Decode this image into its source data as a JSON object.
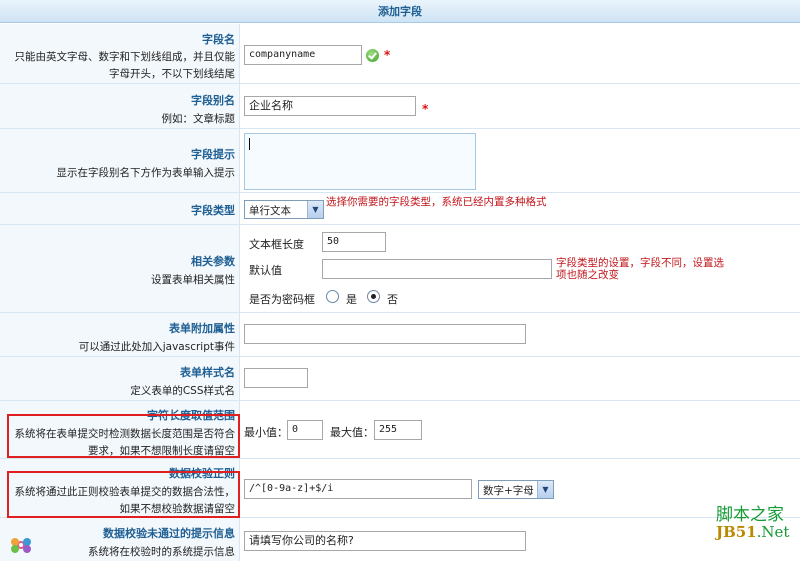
{
  "header": {
    "title": "添加字段"
  },
  "rows": {
    "field_name": {
      "label": "字段名",
      "desc1": "只能由英文字母、数字和下划线组成，并且仅能",
      "desc2": "字母开头，不以下划线结尾",
      "value": "companyname",
      "required": "*"
    },
    "field_alias": {
      "label": "字段别名",
      "desc": "例如：文章标题",
      "value": "企业名称",
      "required": "*"
    },
    "field_tip": {
      "label": "字段提示",
      "desc": "显示在字段别名下方作为表单输入提示",
      "value": ""
    },
    "field_type": {
      "label": "字段类型",
      "selected": "单行文本",
      "hint": "选择你需要的字段类型，系统已经内置多种格式"
    },
    "params": {
      "label": "相关参数",
      "desc": "设置表单相关属性",
      "textbox_len_label": "文本框长度",
      "textbox_len_value": "50",
      "default_label": "默认值",
      "default_value": "",
      "password_label": "是否为密码框",
      "yes": "是",
      "no": "否",
      "password_selected": "否",
      "hint1": "字段类型的设置，字段不同，设置选",
      "hint2": "项也随之改变"
    },
    "form_attr": {
      "label": "表单附加属性",
      "desc": "可以通过此处加入javascript事件",
      "value": ""
    },
    "form_style": {
      "label": "表单样式名",
      "desc": "定义表单的CSS样式名",
      "value": ""
    },
    "length_range": {
      "label": "字符长度取值范围",
      "desc1": "系统将在表单提交时检测数据长度范围是否符合",
      "desc2": "要求，如果不想限制长度请留空",
      "min_label": "最小值：",
      "min_value": "0",
      "max_label": "最大值：",
      "max_value": "255"
    },
    "regex": {
      "label": "数据校验正则",
      "desc1": "系统将通过此正则校验表单提交的数据合法性，",
      "desc2": "如果不想校验数据请留空",
      "value": "/^[0-9a-z]+$/i",
      "preset_selected": "数字+字母"
    },
    "error_msg": {
      "label": "数据校验未通过的提示信息",
      "desc": "系统将在校验时的系统提示信息",
      "value": "请填写你公司的名称?"
    }
  },
  "watermark": {
    "cn": "脚本之家",
    "en_left": "JB51",
    "en_right": ".Net"
  },
  "colors": {
    "label_title": "#1f5f93",
    "hint_red": "#c2151b",
    "redbox": "#e02020"
  }
}
